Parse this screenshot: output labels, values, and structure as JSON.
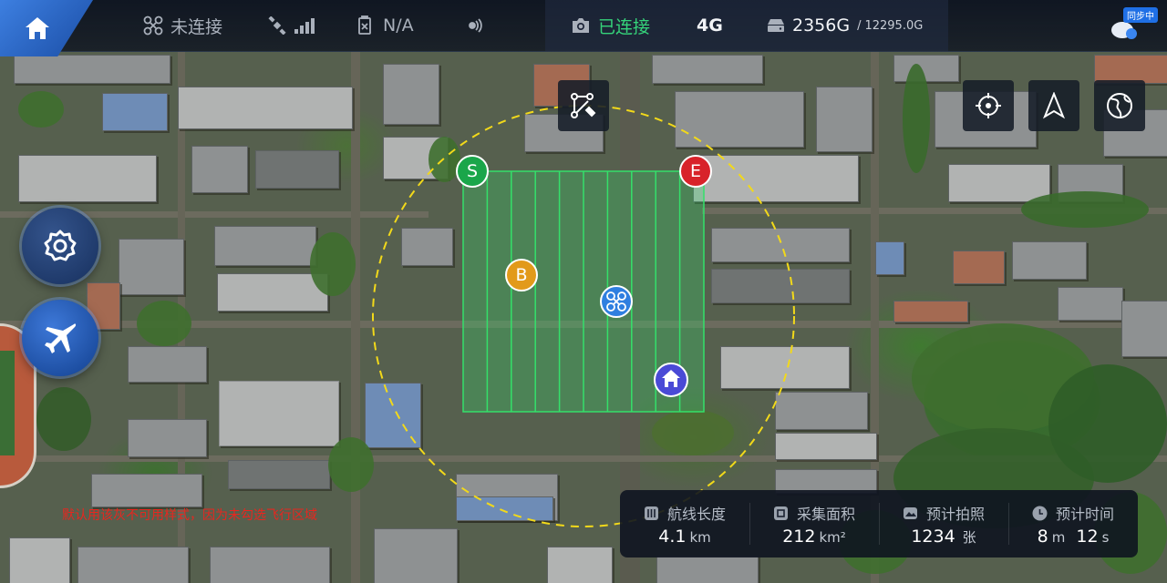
{
  "topbar": {
    "drone_status": "未连接",
    "gps_value": "N/A",
    "camera_status": "已连接",
    "network": "4G",
    "storage_used": "2356G",
    "storage_separator": "/",
    "storage_total": "12295.0G",
    "sync_label": "同步中"
  },
  "mission": {
    "start_label": "S",
    "end_label": "E",
    "breakpoint_label": "B",
    "colors": {
      "start": "#1aa64a",
      "end": "#d8232a",
      "breakpoint": "#e29a1a",
      "area": "#34e06a",
      "boundary": "#f2d91a",
      "home": "#4a4ad6",
      "drone": "#2f7fe0"
    },
    "strip_count": 10
  },
  "warning_text": "默认用该灰不可用样式，因为未勾选飞行区域",
  "stats": {
    "route_length": {
      "label": "航线长度",
      "value": "4.1",
      "unit": "km"
    },
    "area": {
      "label": "采集面积",
      "value": "212",
      "unit": "km²"
    },
    "photos": {
      "label": "预计拍照",
      "value": "1234",
      "unit": "张"
    },
    "time": {
      "label": "预计时间",
      "minutes": "8",
      "m_unit": "m",
      "seconds": "12",
      "s_unit": "s"
    }
  },
  "icons": [
    "home-icon",
    "drone-icon",
    "satellite-icon",
    "signal-icon",
    "battery-icon",
    "rtk-icon",
    "camera-icon",
    "storage-icon",
    "cloud-sync-icon",
    "edit-route-icon",
    "locate-icon",
    "compass-icon",
    "globe-icon",
    "settings-icon",
    "airplane-icon"
  ]
}
